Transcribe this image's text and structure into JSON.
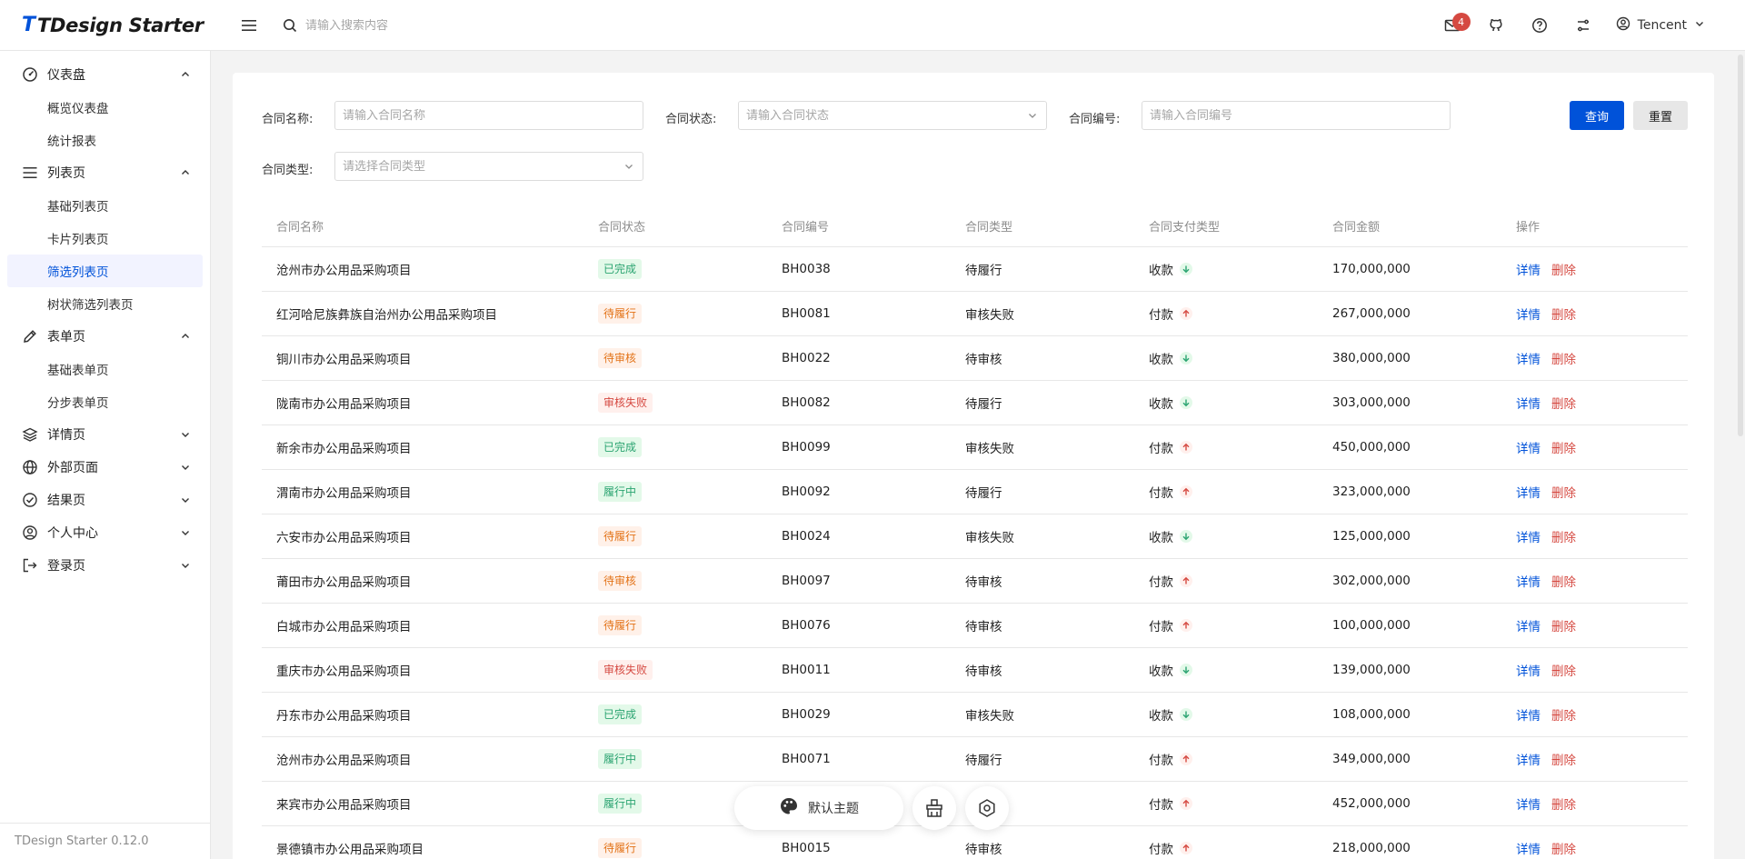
{
  "app": {
    "logo_mark": "T",
    "logo_text": "TDesign Starter",
    "version": "TDesign Starter 0.12.0"
  },
  "header": {
    "search_placeholder": "请输入搜索内容",
    "notification_count": "4",
    "user_name": "Tencent",
    "icons": [
      "menu-fold-icon",
      "search-icon",
      "mail-icon",
      "github-icon",
      "help-circle-icon",
      "setting-icon",
      "user-circle-icon",
      "chevron-down-icon"
    ]
  },
  "sidebar": {
    "groups": [
      {
        "label": "仪表盘",
        "icon": "dashboard-icon",
        "expanded": true,
        "items": [
          {
            "label": "概览仪表盘"
          },
          {
            "label": "统计报表"
          }
        ]
      },
      {
        "label": "列表页",
        "icon": "view-list-icon",
        "expanded": true,
        "items": [
          {
            "label": "基础列表页"
          },
          {
            "label": "卡片列表页"
          },
          {
            "label": "筛选列表页",
            "active": true
          },
          {
            "label": "树状筛选列表页"
          }
        ]
      },
      {
        "label": "表单页",
        "icon": "edit-icon",
        "expanded": true,
        "items": [
          {
            "label": "基础表单页"
          },
          {
            "label": "分步表单页"
          }
        ]
      },
      {
        "label": "详情页",
        "icon": "layers-icon",
        "expanded": false,
        "items": []
      },
      {
        "label": "外部页面",
        "icon": "internet-icon",
        "expanded": false,
        "items": []
      },
      {
        "label": "结果页",
        "icon": "check-circle-icon",
        "expanded": false,
        "items": []
      },
      {
        "label": "个人中心",
        "icon": "user-circle-icon",
        "expanded": false,
        "items": []
      },
      {
        "label": "登录页",
        "icon": "logout-icon",
        "expanded": false,
        "items": []
      }
    ]
  },
  "filters": {
    "name": {
      "label": "合同名称:",
      "placeholder": "请输入合同名称"
    },
    "status": {
      "label": "合同状态:",
      "placeholder": "请输入合同状态"
    },
    "number": {
      "label": "合同编号:",
      "placeholder": "请输入合同编号"
    },
    "type": {
      "label": "合同类型:",
      "placeholder": "请选择合同类型"
    },
    "query_label": "查询",
    "reset_label": "重置"
  },
  "table": {
    "columns": [
      "合同名称",
      "合同状态",
      "合同编号",
      "合同类型",
      "合同支付类型",
      "合同金额",
      "操作"
    ],
    "detail_label": "详情",
    "delete_label": "删除",
    "rows": [
      {
        "name": "沧州市办公用品采购项目",
        "status": "已完成",
        "status_kind": "done",
        "number": "BH0038",
        "type": "待履行",
        "pay": "收款",
        "pay_dir": "in",
        "amount": "170,000,000"
      },
      {
        "name": "红河哈尼族彝族自治州办公用品采购项目",
        "status": "待履行",
        "status_kind": "pending",
        "number": "BH0081",
        "type": "审核失败",
        "pay": "付款",
        "pay_dir": "out",
        "amount": "267,000,000"
      },
      {
        "name": "铜川市办公用品采购项目",
        "status": "待审核",
        "status_kind": "pending",
        "number": "BH0022",
        "type": "待审核",
        "pay": "收款",
        "pay_dir": "in",
        "amount": "380,000,000"
      },
      {
        "name": "陇南市办公用品采购项目",
        "status": "审核失败",
        "status_kind": "fail",
        "number": "BH0082",
        "type": "待履行",
        "pay": "收款",
        "pay_dir": "in",
        "amount": "303,000,000"
      },
      {
        "name": "新余市办公用品采购项目",
        "status": "已完成",
        "status_kind": "done",
        "number": "BH0099",
        "type": "审核失败",
        "pay": "付款",
        "pay_dir": "out",
        "amount": "450,000,000"
      },
      {
        "name": "渭南市办公用品采购项目",
        "status": "履行中",
        "status_kind": "running",
        "number": "BH0092",
        "type": "待履行",
        "pay": "付款",
        "pay_dir": "out",
        "amount": "323,000,000"
      },
      {
        "name": "六安市办公用品采购项目",
        "status": "待履行",
        "status_kind": "pending",
        "number": "BH0024",
        "type": "审核失败",
        "pay": "收款",
        "pay_dir": "in",
        "amount": "125,000,000"
      },
      {
        "name": "莆田市办公用品采购项目",
        "status": "待审核",
        "status_kind": "pending",
        "number": "BH0097",
        "type": "待审核",
        "pay": "付款",
        "pay_dir": "out",
        "amount": "302,000,000"
      },
      {
        "name": "白城市办公用品采购项目",
        "status": "待履行",
        "status_kind": "pending",
        "number": "BH0076",
        "type": "待审核",
        "pay": "付款",
        "pay_dir": "out",
        "amount": "100,000,000"
      },
      {
        "name": "重庆市办公用品采购项目",
        "status": "审核失败",
        "status_kind": "fail",
        "number": "BH0011",
        "type": "待审核",
        "pay": "收款",
        "pay_dir": "in",
        "amount": "139,000,000"
      },
      {
        "name": "丹东市办公用品采购项目",
        "status": "已完成",
        "status_kind": "done",
        "number": "BH0029",
        "type": "审核失败",
        "pay": "收款",
        "pay_dir": "in",
        "amount": "108,000,000"
      },
      {
        "name": "沧州市办公用品采购项目",
        "status": "履行中",
        "status_kind": "running",
        "number": "BH0071",
        "type": "待履行",
        "pay": "付款",
        "pay_dir": "out",
        "amount": "349,000,000"
      },
      {
        "name": "来宾市办公用品采购项目",
        "status": "履行中",
        "status_kind": "running",
        "number": "",
        "type": "",
        "pay": "付款",
        "pay_dir": "out",
        "amount": "452,000,000"
      },
      {
        "name": "景德镇市办公用品采购项目",
        "status": "待履行",
        "status_kind": "pending",
        "number": "BH0015",
        "type": "待审核",
        "pay": "付款",
        "pay_dir": "out",
        "amount": "218,000,000"
      }
    ]
  },
  "float_bar": {
    "theme_label": "默认主题",
    "icons": [
      "palette-icon",
      "clear-icon",
      "setting-icon"
    ]
  },
  "colors": {
    "brand": "#0052d9",
    "success": "#2ba471",
    "warning": "#e37318",
    "error": "#d54941"
  }
}
